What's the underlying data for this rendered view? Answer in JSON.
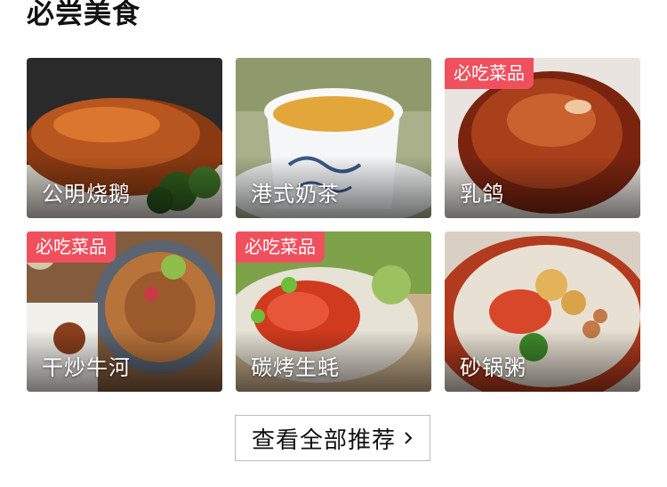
{
  "section_title": "必尝美食",
  "badge_label": "必吃菜品",
  "dishes": [
    {
      "name": "公明烧鹅",
      "badge": false
    },
    {
      "name": "港式奶茶",
      "badge": false
    },
    {
      "name": "乳鸽",
      "badge": true
    },
    {
      "name": "干炒牛河",
      "badge": true
    },
    {
      "name": "碳烤生蚝",
      "badge": true
    },
    {
      "name": "砂锅粥",
      "badge": false
    }
  ],
  "see_all_label": "查看全部推荐",
  "colors": {
    "badge": "#f0505e",
    "button_border": "#bdbdbd",
    "text": "#111111"
  },
  "icons": {
    "see_all": "chevron-right-icon"
  }
}
